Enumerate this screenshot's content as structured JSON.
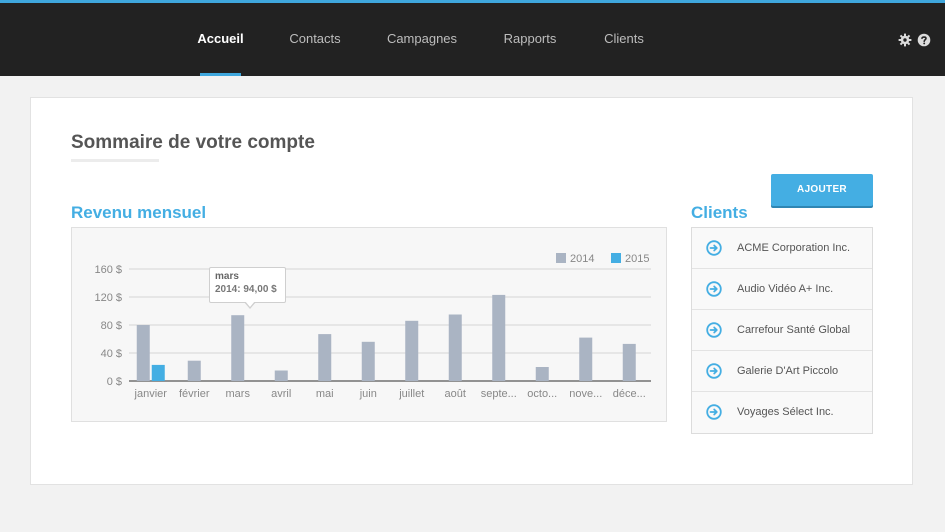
{
  "nav": {
    "items": [
      {
        "label": "Accueil",
        "active": true
      },
      {
        "label": "Contacts",
        "active": false
      },
      {
        "label": "Campagnes",
        "active": false
      },
      {
        "label": "Rapports",
        "active": false
      },
      {
        "label": "Clients",
        "active": false
      }
    ],
    "icons": [
      "gear-icon",
      "help-icon"
    ],
    "accent_color": "#3fa7dd"
  },
  "page": {
    "title": "Sommaire de votre compte",
    "add_button_label": "AJOUTER",
    "revenue_title": "Revenu mensuel",
    "clients_title": "Clients"
  },
  "clients": [
    {
      "name": "ACME Corporation Inc.",
      "icon": "arrow-circle-right-icon"
    },
    {
      "name": "Audio Vidéo A+ Inc.",
      "icon": "arrow-circle-right-icon"
    },
    {
      "name": "Carrefour Santé Global",
      "icon": "arrow-circle-right-icon"
    },
    {
      "name": "Galerie D'Art Piccolo",
      "icon": "arrow-circle-right-icon"
    },
    {
      "name": "Voyages Sélect Inc.",
      "icon": "arrow-circle-right-icon"
    }
  ],
  "tooltip": {
    "title": "mars",
    "value": "2014: 94,00 $"
  },
  "chart_data": {
    "type": "bar",
    "categories": [
      "janvier",
      "février",
      "mars",
      "avril",
      "mai",
      "juin",
      "juillet",
      "août",
      "septe...",
      "octo...",
      "nove...",
      "déce..."
    ],
    "series": [
      {
        "name": "2014",
        "color": "#aab4c3",
        "values": [
          80,
          29,
          94,
          15,
          67,
          56,
          86,
          95,
          123,
          20,
          62,
          53
        ]
      },
      {
        "name": "2015",
        "color": "#44aee3",
        "values": [
          23,
          null,
          null,
          null,
          null,
          null,
          null,
          null,
          null,
          null,
          null,
          null
        ]
      }
    ],
    "yticks": [
      "0 $",
      "40 $",
      "80 $",
      "120 $",
      "160 $"
    ],
    "ytick_values": [
      0,
      40,
      80,
      120,
      160
    ],
    "ylim": [
      0,
      160
    ],
    "grid": true,
    "legend_position": "top-right"
  }
}
